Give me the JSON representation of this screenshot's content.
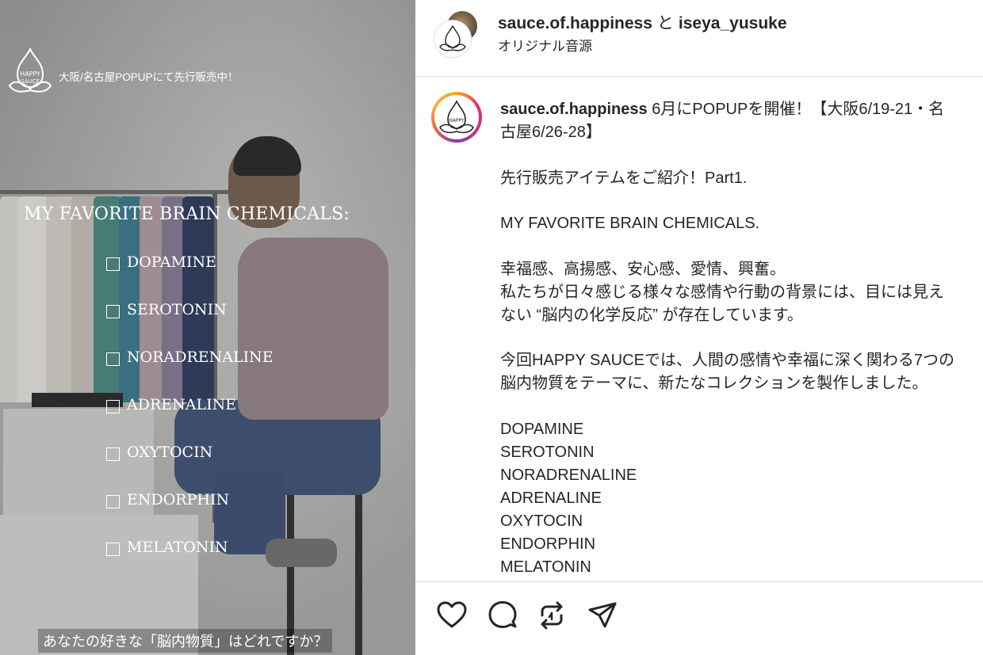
{
  "photo": {
    "popup_text": "大阪/名古屋POPUPにて先行販売中！",
    "title": "MY FAVORITE BRAIN CHEMICALS:",
    "checklist": [
      "DOPAMINE",
      "SEROTONIN",
      "NORADRENALINE",
      "ADRENALINE",
      "OXYTOCIN",
      "ENDORPHIN",
      "MELATONIN"
    ],
    "caption": "あなたの好きな「脳内物質」はどれですか？"
  },
  "header": {
    "user1": "sauce.of.happiness",
    "conjunction": "と",
    "user2": "iseya_yusuke",
    "audio": "オリジナル音源"
  },
  "post": {
    "username": "sauce.of.happiness",
    "line1_rest": "6月にPOPUPを開催！【大阪6/19-21・名",
    "line2": "古屋6/26-28】",
    "line3": "先行販売アイテムをご紹介！Part1.",
    "line4": "MY FAVORITE BRAIN CHEMICALS.",
    "line5": "幸福感、高揚感、安心感、愛情、興奮。",
    "line6": "私たちが日々感じる様々な感情や行動の背景には、目には見え",
    "line7": "ない “脳内の化学反応” が存在しています。",
    "line8": "今回HAPPY SAUCEでは、人間の感情や幸福に深く関わる7つの",
    "line9": "脳内物質をテーマに、新たなコレクションを製作しました。",
    "chemicals": [
      "DOPAMINE",
      "SEROTONIN",
      "NORADRENALINE",
      "ADRENALINE",
      "OXYTOCIN",
      "ENDORPHIN",
      "MELATONIN"
    ]
  },
  "actions": {
    "icons": [
      "heart-icon",
      "comment-icon",
      "repost-icon",
      "share-icon"
    ]
  },
  "colors": {
    "text": "#262626",
    "divider": "#dbdbdb",
    "story_ring": [
      "#f9a825",
      "#e1306c",
      "#833ab4"
    ]
  }
}
